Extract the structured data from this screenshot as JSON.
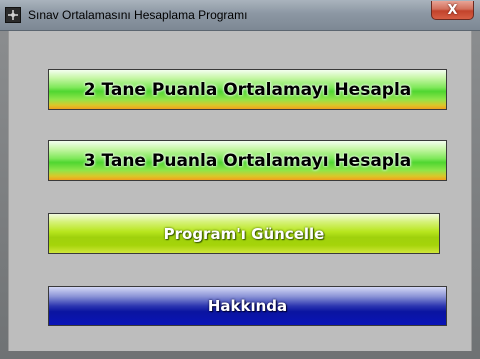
{
  "window": {
    "title": "Sınav Ortalamasını Hesaplama Programı",
    "close_label": "X",
    "icon": "app-icon"
  },
  "buttons": {
    "two_scores": "2 Tane Puanla Ortalamayı Hesapla",
    "three_scores": "3 Tane Puanla Ortalamayı Hesapla",
    "update": "Program'ı Güncelle",
    "about": "Hakkında"
  },
  "colors": {
    "client_background": "#bdbdbd",
    "green_button": "#4fd630",
    "lime_button": "#b8e61e",
    "blue_button": "#0a14a0"
  }
}
